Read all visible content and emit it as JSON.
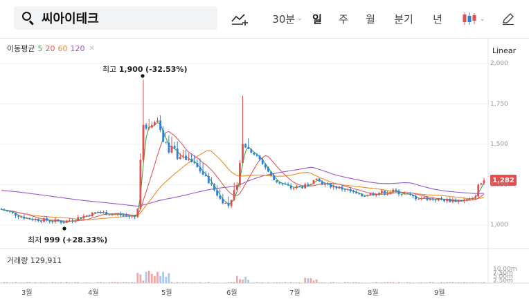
{
  "search": {
    "stock_name": "씨아이테크",
    "icon": "search-icon"
  },
  "toolbar": {
    "indicator_icon": "chart-indicator-add-icon",
    "period_selected": "30분",
    "periods": [
      "일",
      "주",
      "월",
      "분기",
      "년"
    ],
    "active_period": "일",
    "chart_type_icon": "candlestick-icon",
    "draw_icon": "pencil-icon"
  },
  "legend": {
    "title": "이동평균",
    "ma": [
      "5",
      "20",
      "60",
      "120"
    ]
  },
  "scale": {
    "label": "Linear"
  },
  "price_annotations": {
    "high": {
      "prefix": "최고",
      "value": "1,900",
      "change": "(-32.53%)"
    },
    "low": {
      "prefix": "최저",
      "value": "999",
      "change": "(+28.33%)"
    }
  },
  "current_price": "1,282",
  "y_axis": [
    "2,000",
    "1,750",
    "1,500",
    "1,250",
    "1,000"
  ],
  "volume": {
    "label": "거래량",
    "value": "129,911",
    "ticks": [
      "10.00m",
      "7.50m",
      "5.00m",
      "2.50m"
    ]
  },
  "x_axis": [
    "3월",
    "4월",
    "5월",
    "6월",
    "7월",
    "8월",
    "9월"
  ],
  "colors": {
    "up": "#e54e4e",
    "down": "#2f7fd8",
    "ma5": "#3aa845",
    "ma20": "#e05a5a",
    "ma60": "#f08a24",
    "ma120": "#9a55c9"
  }
}
